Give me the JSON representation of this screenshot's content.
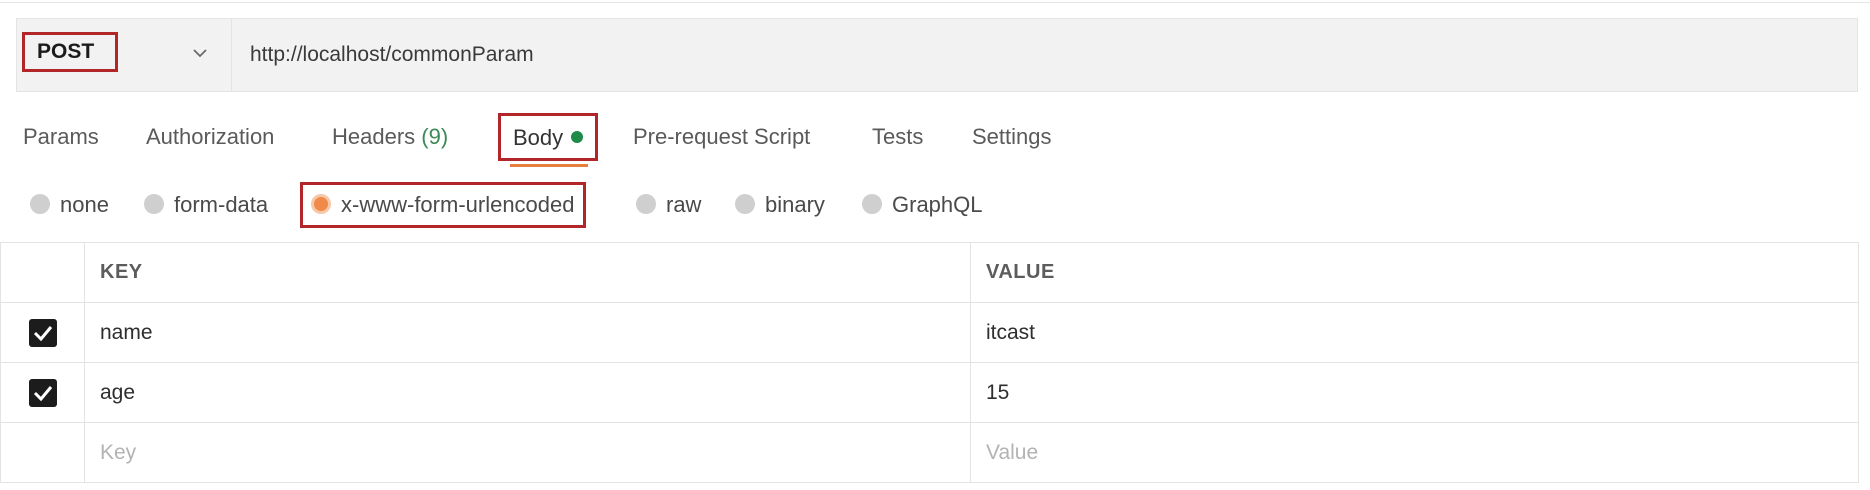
{
  "request": {
    "method": "POST",
    "url": "http://localhost/commonParam"
  },
  "tabs": [
    {
      "label": "Params"
    },
    {
      "label": "Authorization"
    },
    {
      "label": "Headers",
      "count": "(9)"
    },
    {
      "label": "Body",
      "active": true
    },
    {
      "label": "Pre-request Script"
    },
    {
      "label": "Tests"
    },
    {
      "label": "Settings"
    }
  ],
  "body_types": [
    {
      "label": "none"
    },
    {
      "label": "form-data"
    },
    {
      "label": "x-www-form-urlencoded",
      "selected": true
    },
    {
      "label": "raw"
    },
    {
      "label": "binary"
    },
    {
      "label": "GraphQL"
    }
  ],
  "table": {
    "headers": {
      "key": "KEY",
      "value": "VALUE"
    },
    "rows": [
      {
        "checked": true,
        "key": "name",
        "value": "itcast"
      },
      {
        "checked": true,
        "key": "age",
        "value": "15"
      }
    ],
    "placeholder": {
      "key": "Key",
      "value": "Value"
    }
  },
  "colors": {
    "highlight_border": "#b2262a",
    "active_underline": "#e67e3c",
    "body_dot": "#1f8a4a",
    "selected_radio": "#f08a4b",
    "headers_count": "#3a8a55"
  }
}
